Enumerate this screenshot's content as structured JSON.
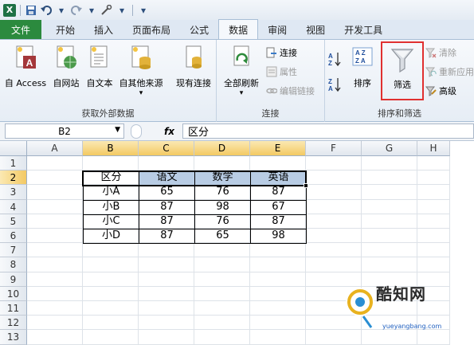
{
  "qat": {
    "logo": "X"
  },
  "tabs": [
    {
      "label": "文件"
    },
    {
      "label": "开始"
    },
    {
      "label": "插入"
    },
    {
      "label": "页面布局"
    },
    {
      "label": "公式"
    },
    {
      "label": "数据",
      "active": true
    },
    {
      "label": "审阅"
    },
    {
      "label": "视图"
    },
    {
      "label": "开发工具"
    }
  ],
  "ribbon": {
    "external": {
      "label": "获取外部数据",
      "buttons": [
        "自 Access",
        "自网站",
        "自文本",
        "自其他来源",
        "现有连接"
      ]
    },
    "connections": {
      "label": "连接",
      "refresh": "全部刷新",
      "items": [
        "连接",
        "属性",
        "编辑链接"
      ]
    },
    "sortfilter": {
      "label": "排序和筛选",
      "sort": "排序",
      "filter": "筛选",
      "items": [
        "清除",
        "重新应用",
        "高级"
      ]
    }
  },
  "formula_bar": {
    "name_box": "B2",
    "fx": "fx",
    "content": "区分"
  },
  "grid": {
    "columns": [
      "A",
      "B",
      "C",
      "D",
      "E",
      "F",
      "G",
      "H"
    ],
    "rows": [
      "1",
      "2",
      "3",
      "4",
      "5",
      "6",
      "7",
      "8",
      "9",
      "10",
      "11",
      "12",
      "13"
    ],
    "selected_columns": [
      "B",
      "C",
      "D",
      "E"
    ],
    "selected_row": "2"
  },
  "table": {
    "headers": [
      "区分",
      "语文",
      "数学",
      "英语"
    ],
    "rows": [
      [
        "小A",
        "65",
        "76",
        "87"
      ],
      [
        "小B",
        "87",
        "98",
        "67"
      ],
      [
        "小C",
        "87",
        "76",
        "87"
      ],
      [
        "小D",
        "87",
        "65",
        "98"
      ]
    ]
  },
  "watermark": {
    "brand": "酷知网",
    "site": "yueyangbang.com"
  },
  "colors": {
    "filter_highlight": "#e03030",
    "header_fill": "#b8cce4",
    "selection": "#f3c963"
  }
}
